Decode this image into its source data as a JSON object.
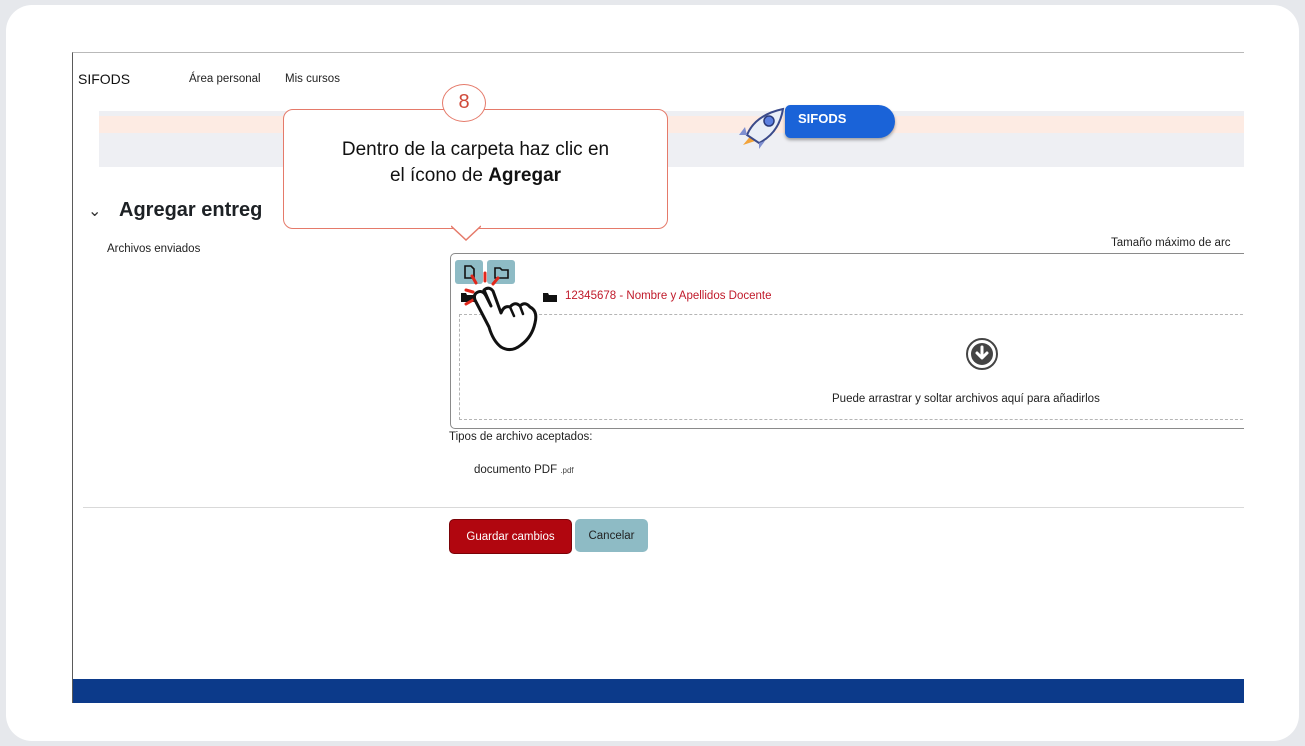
{
  "navbar": {
    "brand": "SIFODS",
    "links": [
      "Área personal",
      "Mis cursos"
    ]
  },
  "banner": {
    "pill_label": "SIFODS"
  },
  "section": {
    "title": "Agregar entreg",
    "files_label": "Archivos enviados",
    "max_size": "Tamaño máximo de arc"
  },
  "file_manager": {
    "folder_path": "12345678 - Nombre y Apellidos Docente",
    "drop_text": "Puede arrastrar y soltar archivos aquí para añadirlos",
    "toolbar_icons": [
      "add-file-icon",
      "create-folder-icon"
    ]
  },
  "accepted": {
    "label": "Tipos de archivo aceptados:",
    "type_name": "documento PDF",
    "type_ext": ".pdf"
  },
  "buttons": {
    "save": "Guardar cambios",
    "cancel": "Cancelar"
  },
  "callout": {
    "step": "8",
    "line1": "Dentro de la carpeta haz clic en",
    "line2_prefix": "el ícono de ",
    "line2_bold": "Agregar"
  },
  "colors": {
    "accent_red": "#b1060f",
    "teal_button": "#8ebbc5",
    "footer_blue": "#0c3a8a",
    "callout_border": "#e57a6a"
  }
}
